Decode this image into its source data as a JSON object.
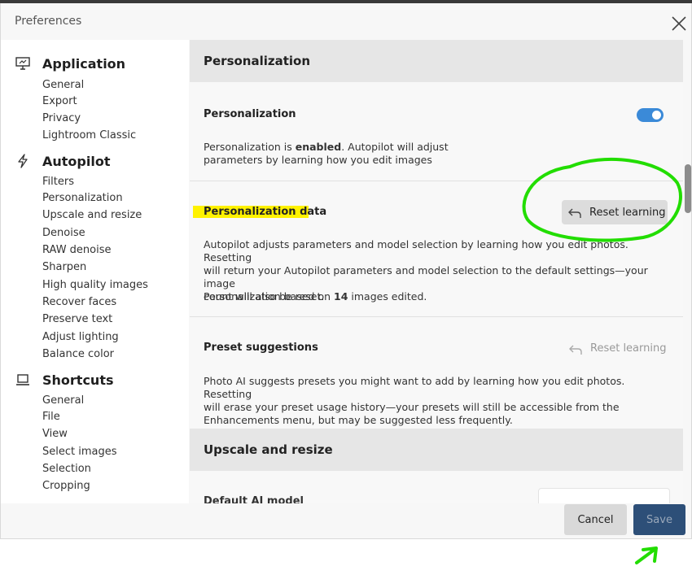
{
  "window": {
    "title": "Preferences"
  },
  "sidebar": {
    "groups": [
      {
        "label": "Application",
        "icon": "monitor-icon",
        "items": [
          "General",
          "Export",
          "Privacy",
          "Lightroom Classic"
        ]
      },
      {
        "label": "Autopilot",
        "icon": "lightning-icon",
        "items": [
          "Filters",
          "Personalization",
          "Upscale and resize",
          "Denoise",
          "RAW denoise",
          "Sharpen",
          "High quality images",
          "Recover faces",
          "Preserve text",
          "Adjust lighting",
          "Balance color"
        ]
      },
      {
        "label": "Shortcuts",
        "icon": "laptop-icon",
        "items": [
          "General",
          "File",
          "View",
          "Select images",
          "Selection",
          "Cropping"
        ]
      }
    ]
  },
  "content": {
    "personalization_header": "Personalization",
    "personalization_toggle": {
      "title": "Personalization",
      "enabled": true,
      "desc_pre": "Personalization is ",
      "desc_bold": "enabled",
      "desc_line1_post": ". Autopilot will adjust",
      "desc_line2": "parameters by learning how you edit images"
    },
    "personalization_data": {
      "title": "Personalization data",
      "reset_label": "Reset learning",
      "desc_line1": "Autopilot adjusts parameters and model selection by learning how you edit photos. Resetting",
      "desc_line2": "will return your Autopilot parameters and model selection to the default settings—your image",
      "desc_line3": "count will also be reset.",
      "count_pre": "Personalization based on ",
      "count_value": "14",
      "count_post": " images edited."
    },
    "preset_suggestions": {
      "title": "Preset suggestions",
      "reset_label": "Reset learning",
      "desc_line1": "Photo AI suggests presets you might want to add by learning how you edit photos. Resetting",
      "desc_line2": "will erase your preset usage history—your presets will still be accessible from the",
      "desc_line3": "Enhancements menu, but may be suggested less frequently."
    },
    "upscale_header": "Upscale and resize",
    "default_model_label": "Default AI model"
  },
  "footer": {
    "cancel_label": "Cancel",
    "save_label": "Save"
  },
  "colors": {
    "toggle_on": "#3b8ad8",
    "save_bg": "#2d4f78",
    "annotation_green": "#22dd00",
    "highlight_yellow": "#fff200"
  }
}
